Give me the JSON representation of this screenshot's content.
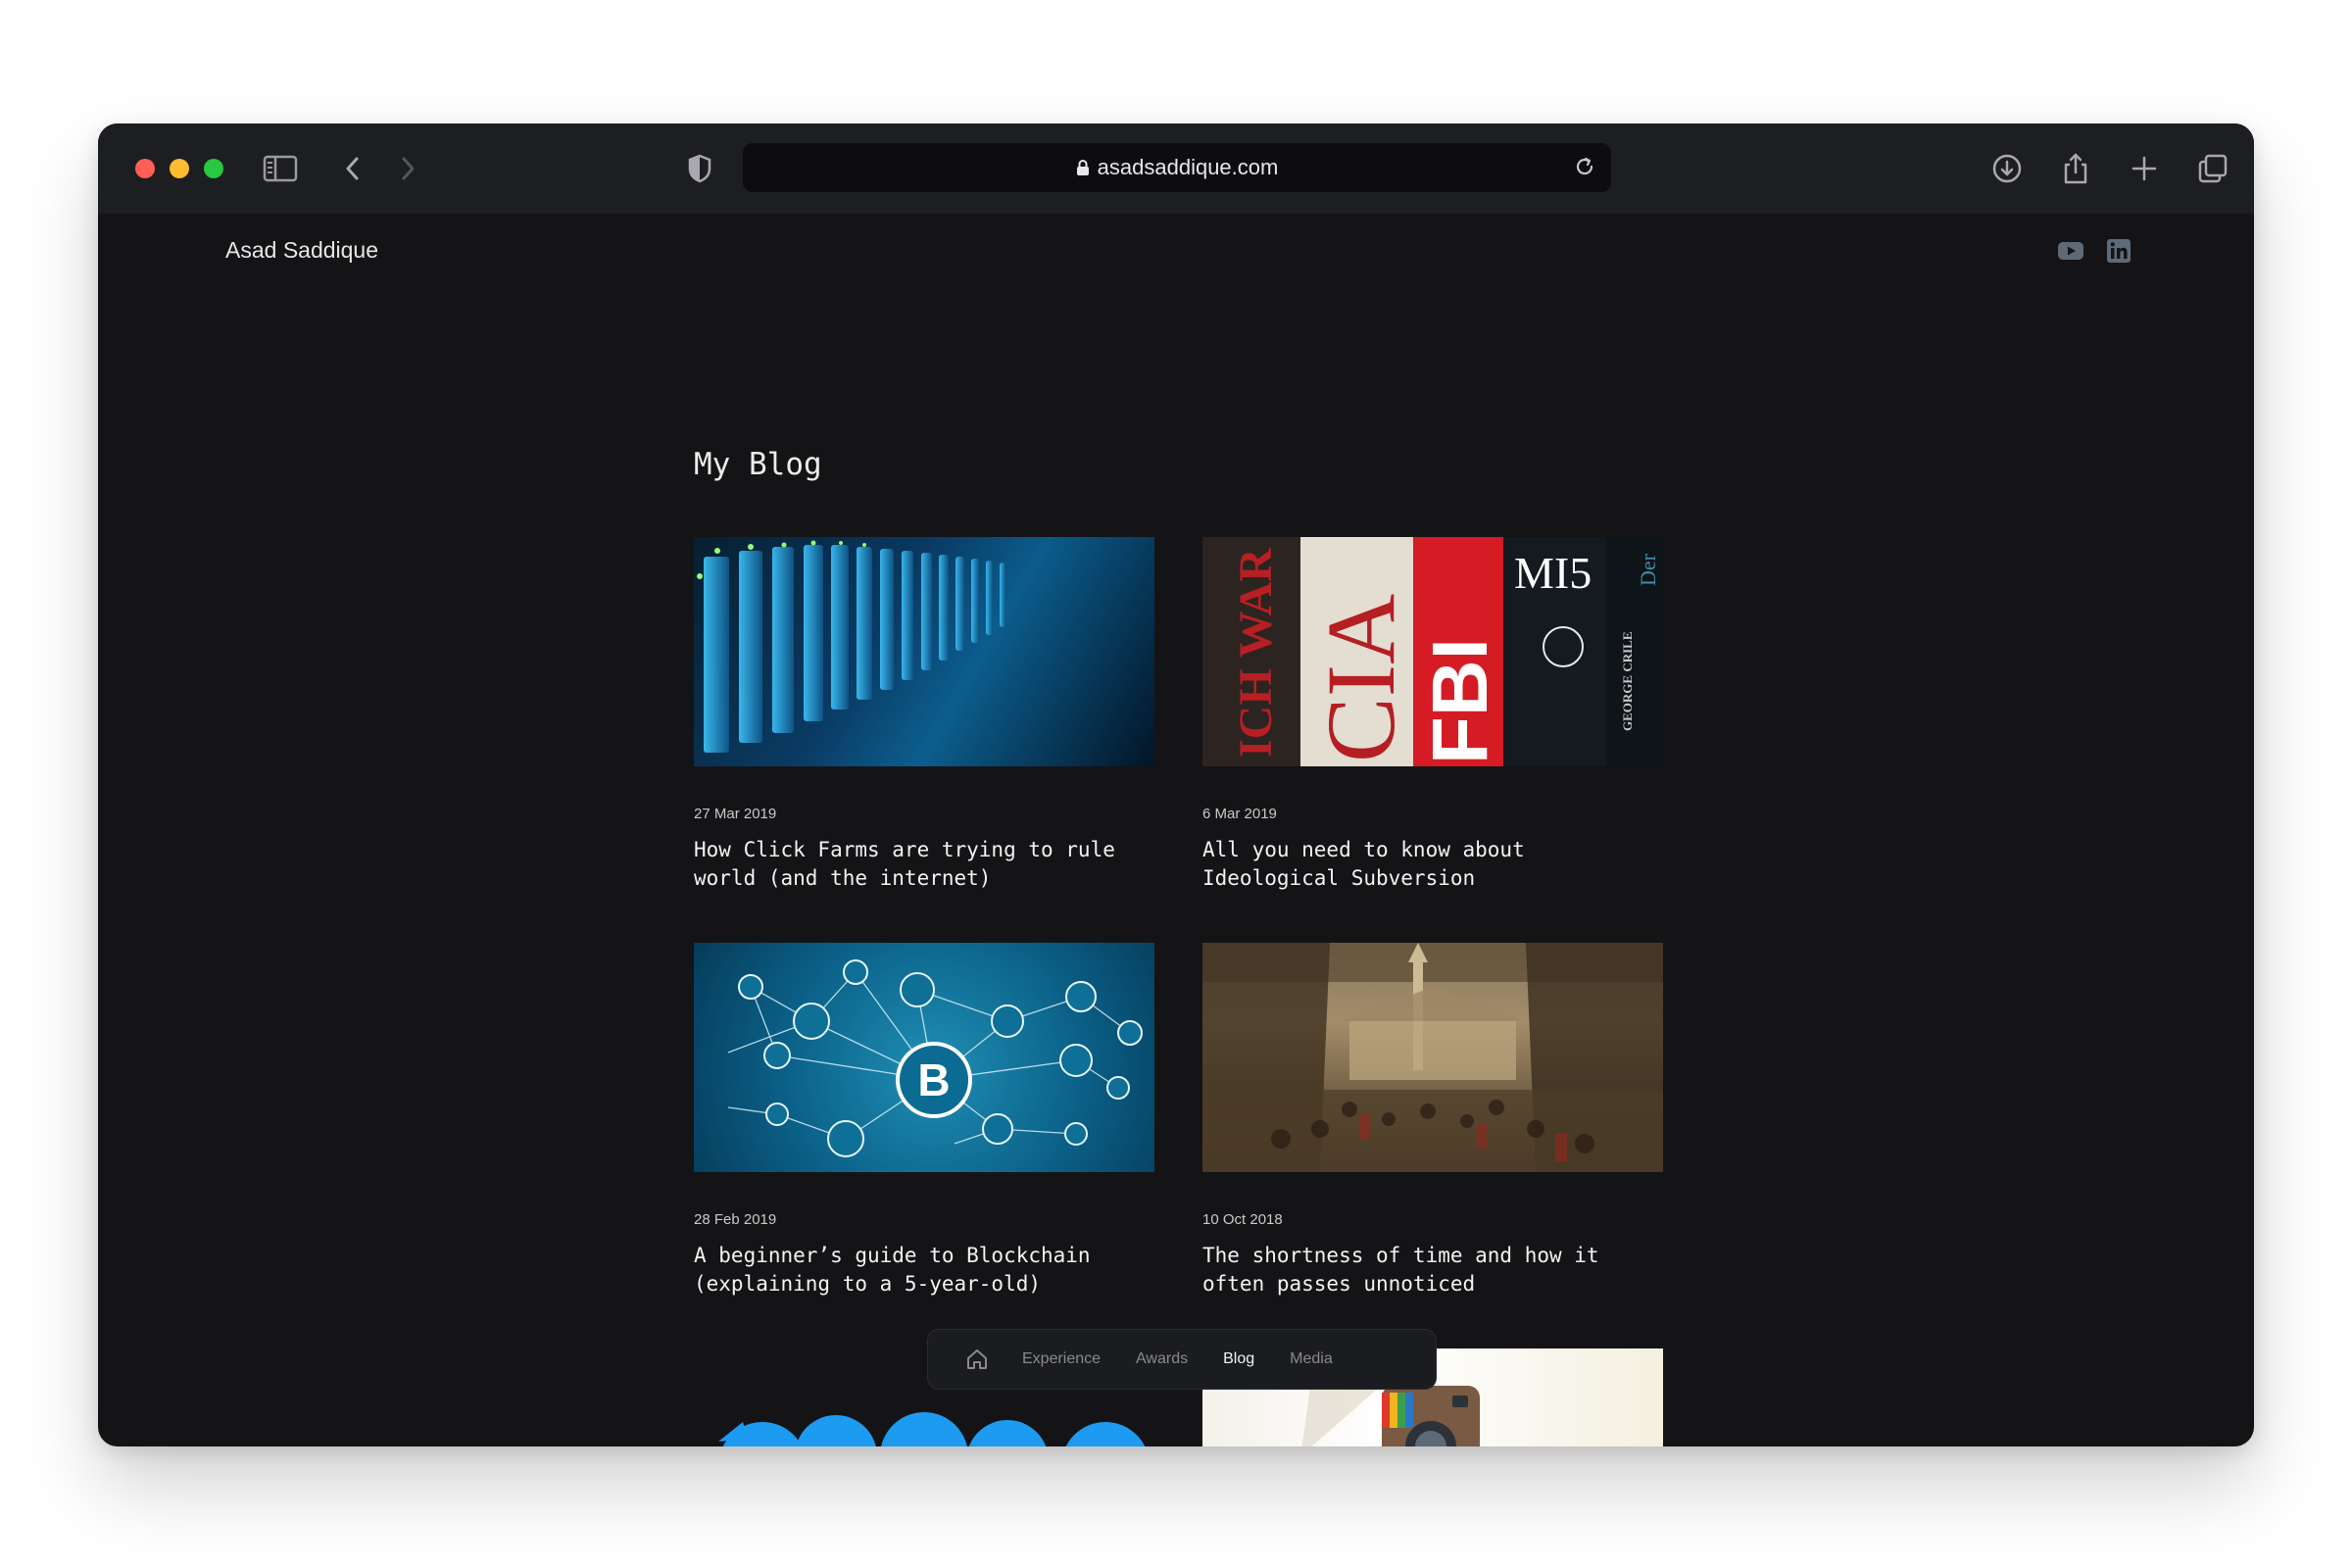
{
  "browser": {
    "url": "asadsaddique.com",
    "icons": [
      "sidebar-icon",
      "back-icon",
      "forward-icon",
      "shield-icon",
      "lock-icon",
      "reload-icon",
      "download-icon",
      "share-icon",
      "new-tab-icon",
      "tabs-overview-icon"
    ]
  },
  "site": {
    "name": "Asad Saddique",
    "social_icons": [
      "youtube-icon",
      "linkedin-icon"
    ]
  },
  "page": {
    "title": "My Blog"
  },
  "posts": [
    {
      "date": "27 Mar 2019",
      "title": "How Click Farms are trying to rule\nworld (and the internet)"
    },
    {
      "date": "6 Mar 2019",
      "title": "All you need to know about\nIdeological Subversion"
    },
    {
      "date": "28 Feb 2019",
      "title": "A beginner’s guide to Blockchain\n(explaining to a 5-year-old)"
    },
    {
      "date": "10 Oct 2018",
      "title": "The shortness of time and how it\noften passes unnoticed"
    }
  ],
  "thumb_text": {
    "book1": "ICH WAR JACK",
    "book2": "CIA",
    "book3": "FBI",
    "book4": "MI5",
    "book5": "GEORGE CRILE",
    "book6": "Der",
    "bitcoin": "B"
  },
  "nav": {
    "items": [
      "Experience",
      "Awards",
      "Blog",
      "Media"
    ],
    "active": "Blog"
  },
  "colors": {
    "background": "#141417",
    "toolbar": "#1d1e21",
    "traffic_red": "#ff5f57",
    "traffic_yellow": "#febc2e",
    "traffic_green": "#28c840"
  }
}
